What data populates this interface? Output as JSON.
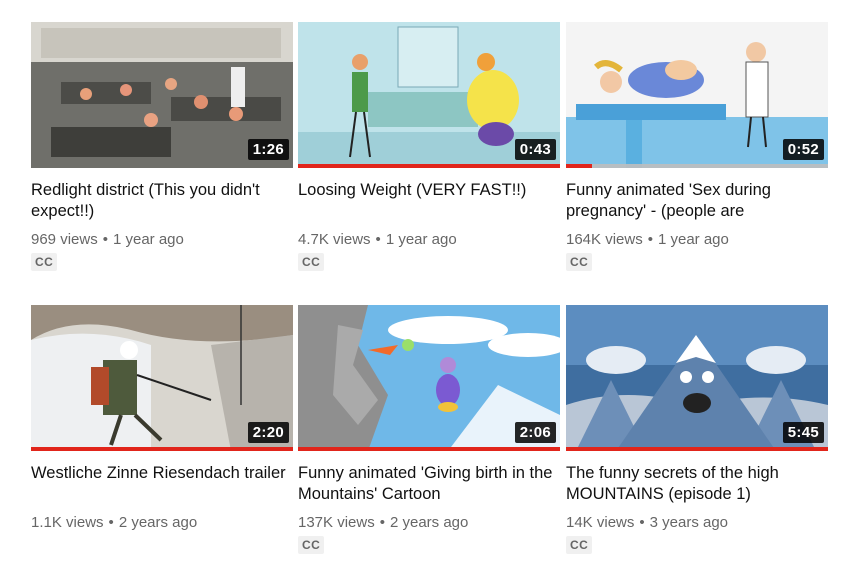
{
  "videos": [
    {
      "title": "Redlight district (This you didn't expect!!)",
      "duration": "1:26",
      "views": "969 views",
      "age": "1 year ago",
      "badge": "CC",
      "progress": 0
    },
    {
      "title": "Loosing Weight (VERY FAST!!)",
      "duration": "0:43",
      "views": "4.7K views",
      "age": "1 year ago",
      "badge": "CC",
      "progress": 1.0
    },
    {
      "title": "Funny animated 'Sex during pregnancy' - (people are",
      "duration": "0:52",
      "views": "164K views",
      "age": "1 year ago",
      "badge": "CC",
      "progress": 0.1
    },
    {
      "title": "Westliche Zinne Riesendach trailer",
      "duration": "2:20",
      "views": "1.1K views",
      "age": "2 years ago",
      "badge": null,
      "progress": 1.0
    },
    {
      "title": "Funny animated 'Giving birth in the Mountains' Cartoon",
      "duration": "2:06",
      "views": "137K views",
      "age": "2 years ago",
      "badge": "CC",
      "progress": 1.0
    },
    {
      "title": "The funny secrets of the high MOUNTAINS (episode 1)",
      "duration": "5:45",
      "views": "14K views",
      "age": "3 years ago",
      "badge": "CC",
      "progress": 1.0
    }
  ],
  "separator": "•",
  "colors": {
    "progress": "#e1251b",
    "duration_bg": "#000000",
    "text": "#111111",
    "meta": "#666666"
  }
}
